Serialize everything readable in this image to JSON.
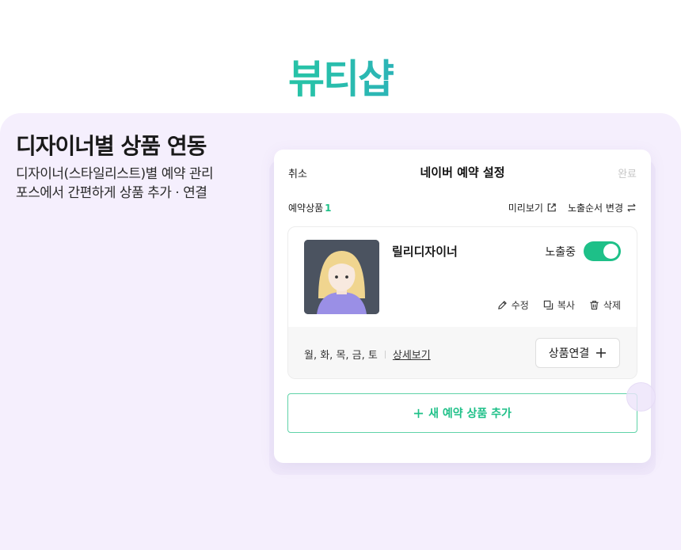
{
  "brand": {
    "title": "뷰티샵"
  },
  "feature": {
    "headline": "디자이너별 상품 연동",
    "desc_line1": "디자이너(스타일리스트)별 예약 관리",
    "desc_line2": "포스에서 간편하게 상품 추가 · 연결"
  },
  "sheet": {
    "cancel_label": "취소",
    "title": "네이버 예약 설정",
    "done_label": "완료",
    "list_label": "예약상품",
    "list_count": "1",
    "preview_label": "미리보기",
    "reorder_label": "노출순서 변경"
  },
  "item": {
    "name": "릴리디자이너",
    "status_label": "노출중",
    "toggle_on": true,
    "edit_label": "수정",
    "copy_label": "복사",
    "delete_label": "삭제",
    "days": "월, 화, 목, 금, 토",
    "detail_label": "상세보기",
    "link_label": "상품연결"
  },
  "add_button": {
    "label": "새 예약 상품 추가"
  },
  "colors": {
    "accent_green": "#1ec088",
    "panel_bg": "#f5effd",
    "brand_gradient_start": "#1ecf8a",
    "brand_gradient_end": "#3f86e8"
  },
  "icons": {
    "preview": "external-link-icon",
    "reorder": "swap-arrows-icon",
    "edit": "pencil-icon",
    "copy": "copy-icon",
    "delete": "trash-icon",
    "link": "plus-icon",
    "add": "plus-icon"
  }
}
